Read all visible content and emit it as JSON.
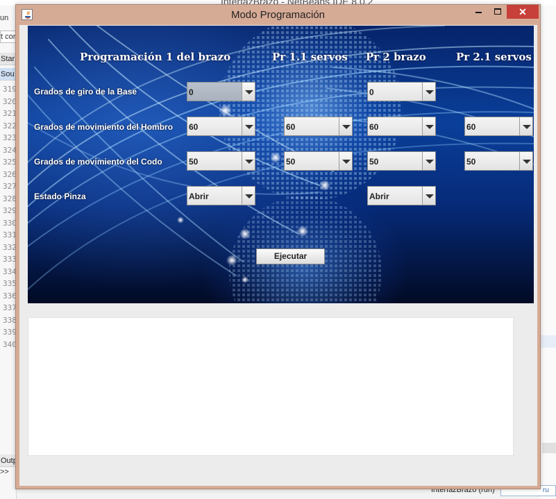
{
  "ide": {
    "title": "InterfazBrazo - NetBeans IDE 8.0.2",
    "left_labels": [
      "un",
      "t cor"
    ],
    "tabs": [
      "Star",
      "Sou"
    ],
    "line_numbers": [
      "319",
      "320",
      "321",
      "322",
      "323",
      "324",
      "325",
      "326",
      "327",
      "328",
      "329",
      "330",
      "331",
      "332",
      "333",
      "334",
      "335",
      "336",
      "337",
      "338",
      "339",
      "340"
    ],
    "output_tab": "Outp",
    "output_arrows": ">>",
    "status_text": "InterfazBrazo (run)",
    "status_box": "ru"
  },
  "dialog": {
    "title": "Modo Programación",
    "close_glyph": "✕",
    "headers": {
      "prog1": "Programación 1 del brazo",
      "pr11": "Pr 1.1 servos",
      "pr2": "Pr 2 brazo",
      "pr21": "Pr 2.1 servos"
    },
    "labels": {
      "base": "Grados de giro de la Base",
      "hombro": "Grados de movimiento del Hombro",
      "codo": "Grados de movimiento del Codo",
      "pinza": "Estado Pinza"
    },
    "combos": {
      "base_p1": "0",
      "base_p2": "0",
      "hombro_p1": "60",
      "hombro_p11": "60",
      "hombro_p2": "60",
      "hombro_p21": "60",
      "codo_p1": "50",
      "codo_p11": "50",
      "codo_p2": "50",
      "codo_p21": "50",
      "pinza_p1": "Abrir",
      "pinza_p2": "Abrir"
    },
    "execute_label": "Ejecutar",
    "output_text": ""
  }
}
